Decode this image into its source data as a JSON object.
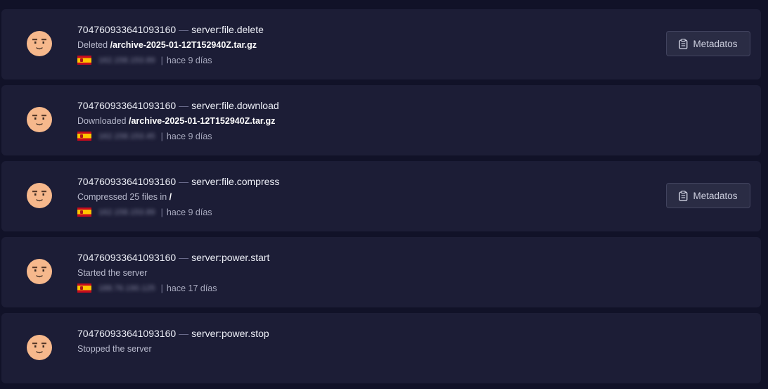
{
  "entries": [
    {
      "user": "704760933641093160",
      "separator": "—",
      "event": "server:file.delete",
      "desc_prefix": "Deleted ",
      "desc_target": "/archive-2025-01-12T152940Z.tar.gz",
      "ip": "162.158.153.89",
      "pipe": "|",
      "time": "hace 9 días",
      "metadata_label": "Metadatos"
    },
    {
      "user": "704760933641093160",
      "separator": "—",
      "event": "server:file.download",
      "desc_prefix": "Downloaded ",
      "desc_target": "/archive-2025-01-12T152940Z.tar.gz",
      "ip": "162.158.153.45",
      "pipe": "|",
      "time": "hace 9 días"
    },
    {
      "user": "704760933641093160",
      "separator": "—",
      "event": "server:file.compress",
      "desc_prefix": "Compressed 25 files in ",
      "desc_target": "/",
      "ip": "162.158.153.89",
      "pipe": "|",
      "time": "hace 9 días",
      "metadata_label": "Metadatos"
    },
    {
      "user": "704760933641093160",
      "separator": "—",
      "event": "server:power.start",
      "desc_prefix": "Started the server",
      "desc_target": "",
      "ip": "188.76.190.125",
      "pipe": "|",
      "time": "hace 17 días"
    },
    {
      "user": "704760933641093160",
      "separator": "—",
      "event": "server:power.stop",
      "desc_prefix": "Stopped the server",
      "desc_target": ""
    }
  ],
  "icons": {
    "avatar": "face-avatar-icon",
    "flag": "spain-flag-icon",
    "metadata": "clipboard-icon"
  },
  "colors": {
    "background": "#111228",
    "card": "#1c1d36",
    "button": "#2a2c44",
    "avatar_skin": "#f6b88c"
  }
}
